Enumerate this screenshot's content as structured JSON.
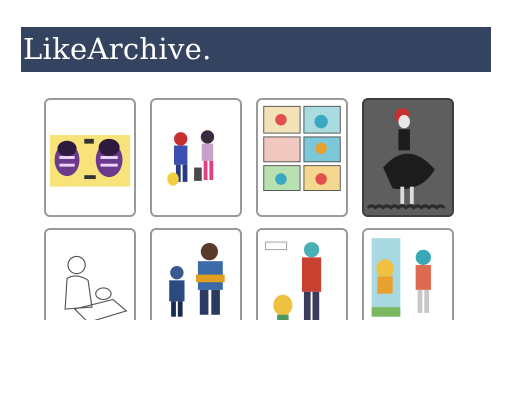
{
  "header": {
    "title": "LikeArchive."
  },
  "colors": {
    "header_bg": "#334360",
    "card_border": "#9a9a9a"
  },
  "gallery": {
    "items": [
      {
        "name": "thumb-purple-creatures"
      },
      {
        "name": "thumb-group-characters"
      },
      {
        "name": "thumb-comic-page"
      },
      {
        "name": "thumb-dark-figure"
      },
      {
        "name": "thumb-sketch-drawing"
      },
      {
        "name": "thumb-hero-figures"
      },
      {
        "name": "thumb-conversation-pair"
      },
      {
        "name": "thumb-standing-pair"
      }
    ]
  }
}
